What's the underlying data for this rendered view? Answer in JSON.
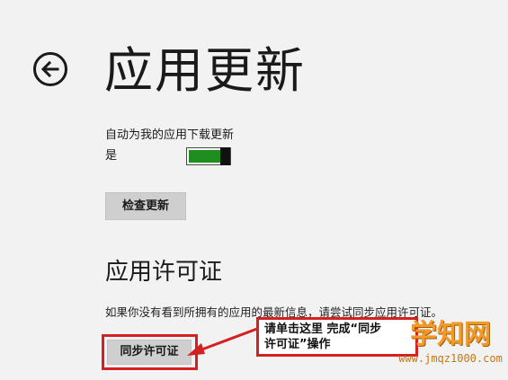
{
  "header": {
    "title": "应用更新"
  },
  "auto_update": {
    "label": "自动为我的应用下载更新",
    "state": "是"
  },
  "check_button": {
    "label": "检查更新"
  },
  "license": {
    "title": "应用许可证",
    "description": "如果你没有看到所拥有的应用的最新信息，请尝试同步应用许可证。",
    "sync_label": "同步许可证"
  },
  "annotation": {
    "line1": "请单击这里 完成“同步",
    "line2": "许可证”操作"
  },
  "watermark": {
    "main": "学知网",
    "sub": "www.jmqz1000.com"
  },
  "colors": {
    "accent_red": "#d42020",
    "toggle_on": "#1e8e1e",
    "watermark": "#f09a2a"
  }
}
